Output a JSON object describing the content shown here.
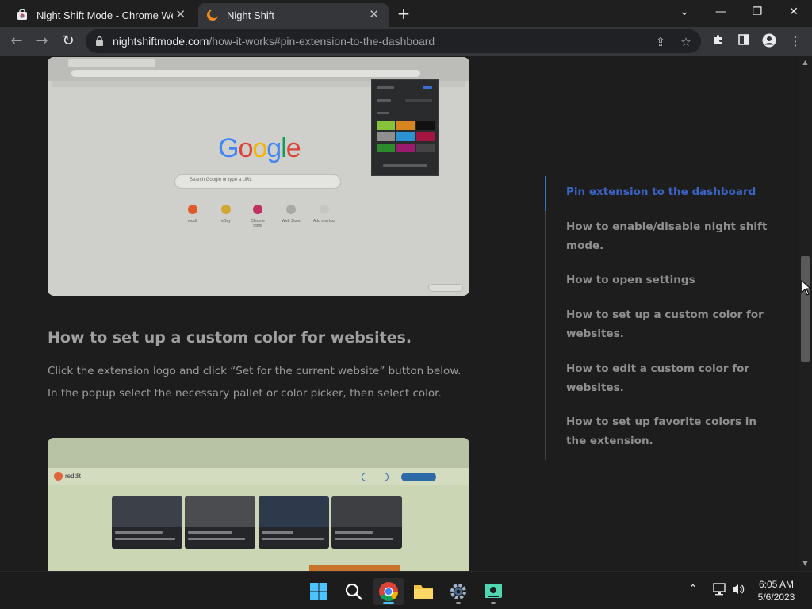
{
  "tabs": [
    {
      "title": "Night Shift Mode - Chrome Web Store",
      "active": false
    },
    {
      "title": "Night Shift",
      "active": true
    }
  ],
  "url": {
    "host": "nightshiftmode.com",
    "path": "/how-it-works#pin-extension-to-the-dashboard"
  },
  "article": {
    "heading": "How to set up a custom color for websites.",
    "body": "Click the extension logo and click “Set for the current website” button below. In the popup select the necessary pallet or color picker, then select color."
  },
  "embedded_screenshot_1": {
    "logo": "Google",
    "search_placeholder": "Search Google or type a URL",
    "shortcuts": [
      "reddit",
      "eBay",
      "Chrome Store",
      "Web Store",
      "Add shortcut"
    ],
    "popup_swatches": [
      "#86c33a",
      "#d7861f",
      "#111111",
      "#8f8f8f",
      "#2b93d1",
      "#a3163f",
      "#2f8a2c",
      "#9a1a6e",
      "#444444"
    ],
    "customize_label": "Customize"
  },
  "embedded_screenshot_2": {
    "site_label": "reddit"
  },
  "toc": {
    "items": [
      {
        "label": "Pin extension to the dashboard",
        "active": true
      },
      {
        "label": "How to enable/disable night shift mode.",
        "active": false
      },
      {
        "label": "How to open settings",
        "active": false
      },
      {
        "label": "How to set up a custom color for websites.",
        "active": false
      },
      {
        "label": "How to edit a custom color for websites.",
        "active": false
      },
      {
        "label": "How to set up favorite colors in the extension.",
        "active": false
      }
    ]
  },
  "clock": {
    "time": "6:05 AM",
    "date": "5/6/2023"
  },
  "colors": {
    "toc_active": "#3b63c4",
    "toc_inactive": "#8f8f8f",
    "page_background": "#1d1d1d",
    "chrome_toolbar": "#35363a"
  },
  "icons": {
    "tab1": "chrome-web-store-icon",
    "tab2": "night-shift-moon-icon",
    "taskbar": [
      "windows-start-icon",
      "search-icon",
      "chrome-icon",
      "file-explorer-icon",
      "settings-icon",
      "night-shift-app-icon"
    ]
  }
}
